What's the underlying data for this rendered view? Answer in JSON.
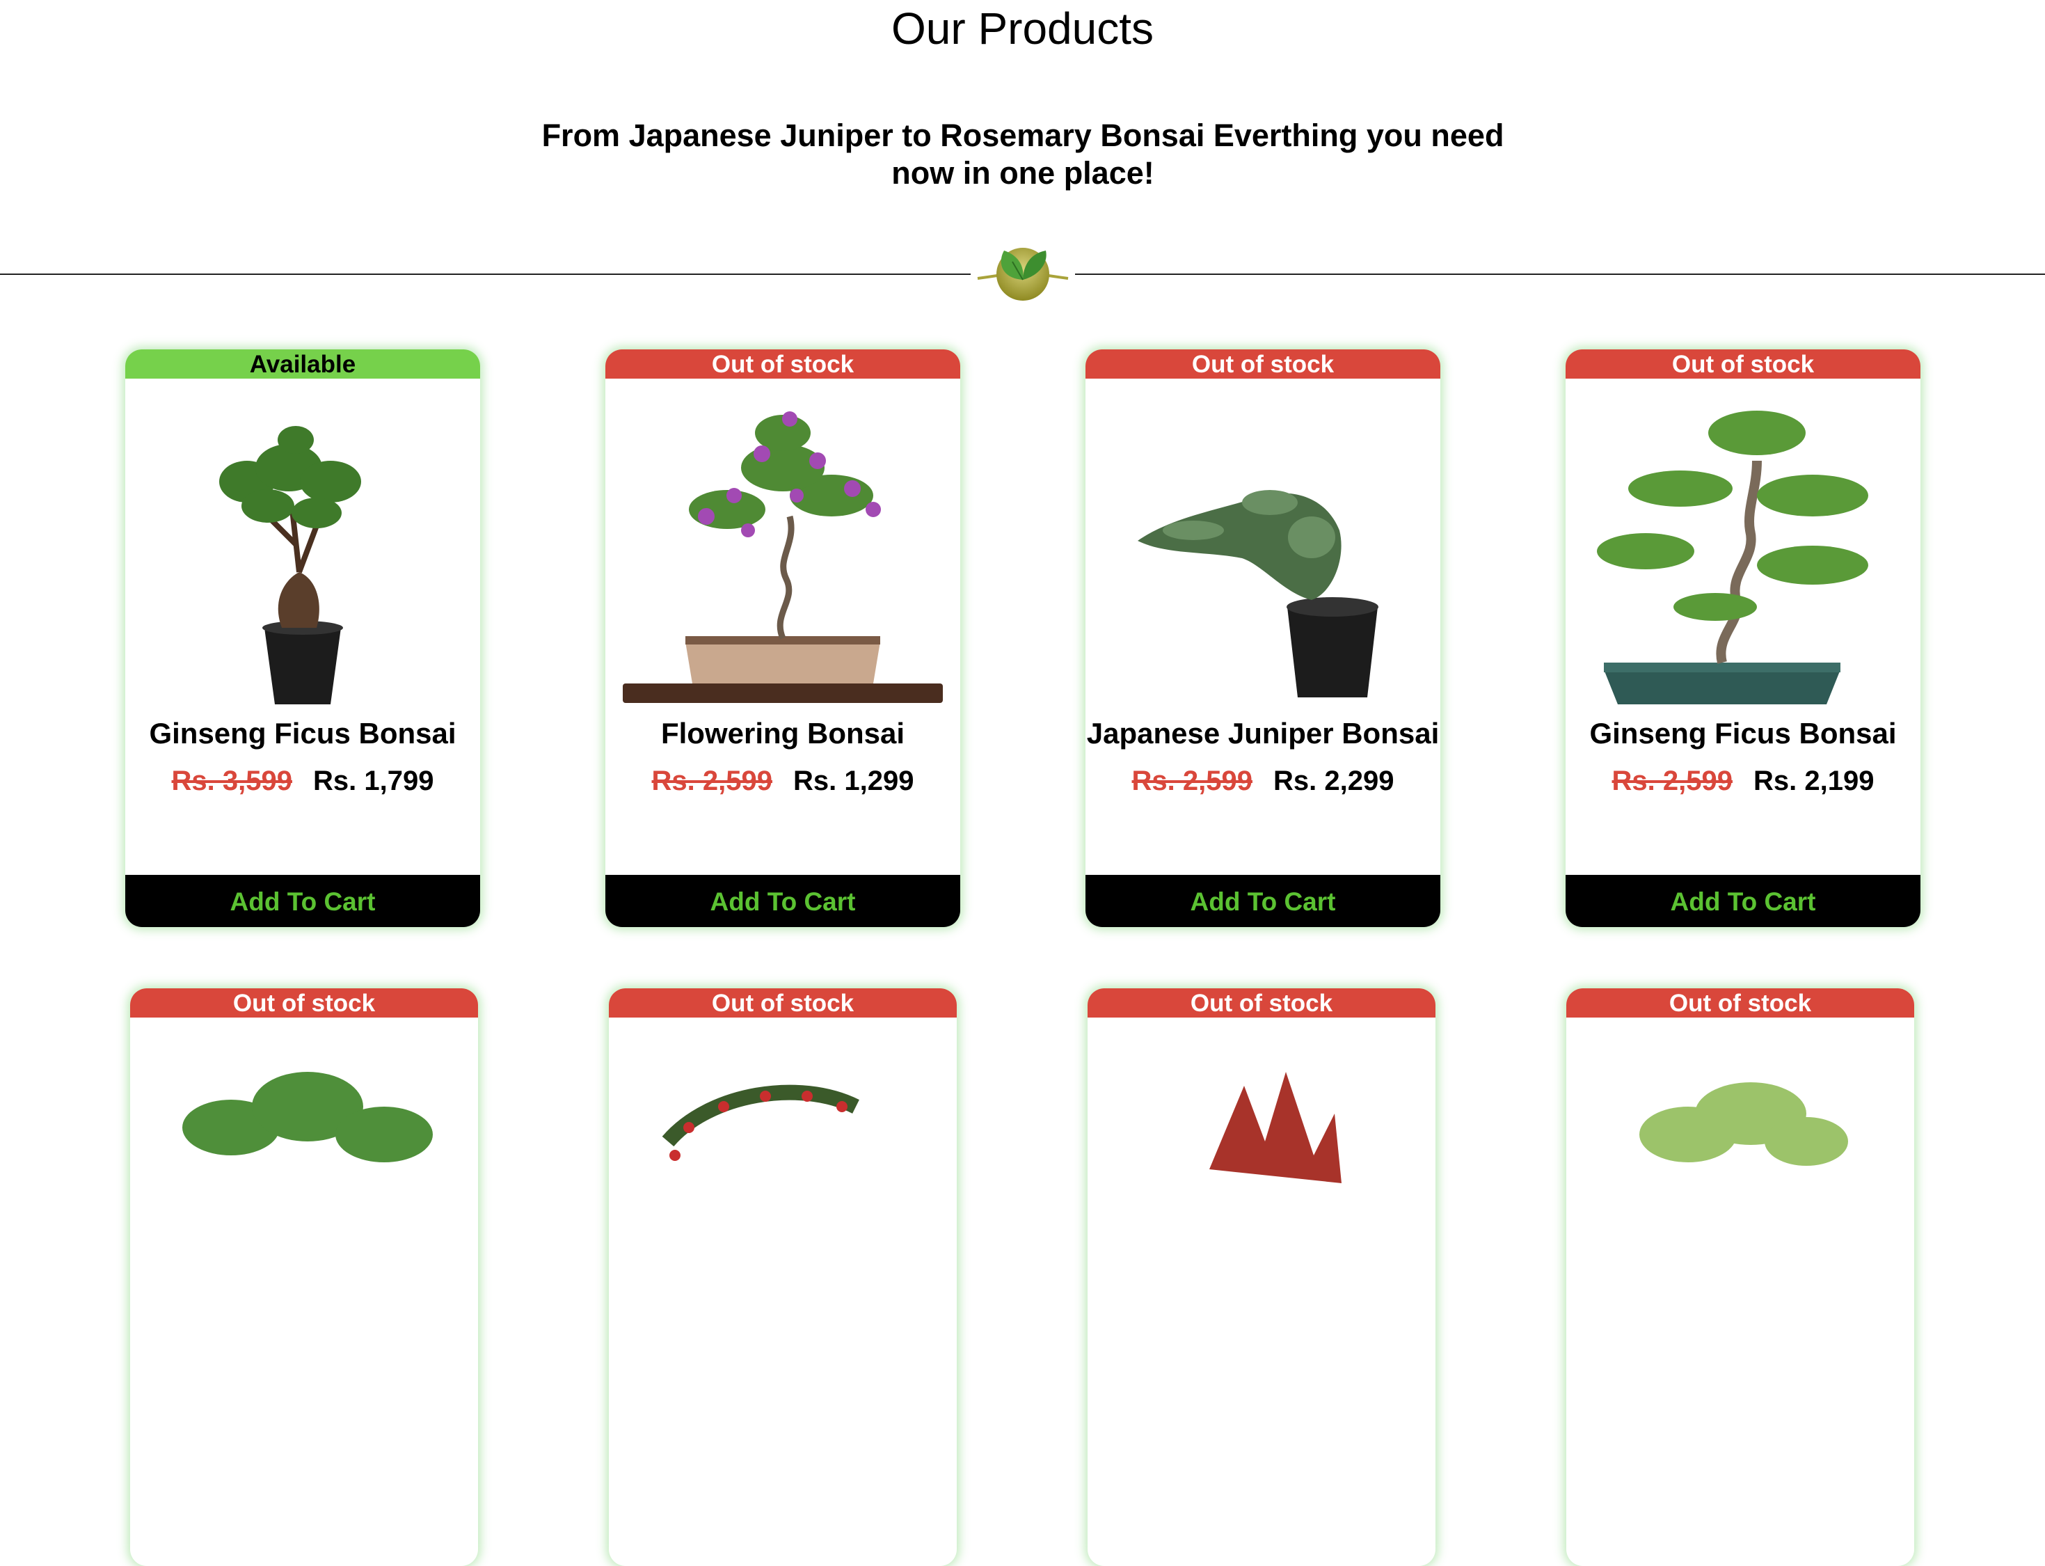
{
  "header": {
    "title": "Our Products",
    "subtitle_line1": "From Japanese Juniper to Rosemary Bonsai Everthing you need",
    "subtitle_line2": "now in one place!"
  },
  "colors": {
    "available": "#76d14b",
    "out_of_stock": "#d9473b",
    "cart_text": "#5bc232",
    "card_glow": "#78d26e"
  },
  "products": [
    {
      "status": "Available",
      "name": "Ginseng Ficus Bonsai",
      "old_price": "Rs. 3,599",
      "price": "Rs. 1,799",
      "cta": "Add To Cart",
      "image": "ficus-in-black-pot"
    },
    {
      "status": "Out of stock",
      "name": "Flowering Bonsai",
      "old_price": "Rs. 2,599",
      "price": "Rs. 1,299",
      "cta": "Add To Cart",
      "image": "flowering-bonsai-on-tray"
    },
    {
      "status": "Out of stock",
      "name": "Japanese Juniper Bonsai",
      "old_price": "Rs. 2,599",
      "price": "Rs. 2,299",
      "cta": "Add To Cart",
      "image": "juniper-in-black-pot"
    },
    {
      "status": "Out of stock",
      "name": "Ginseng Ficus Bonsai",
      "old_price": "Rs. 2,599",
      "price": "Rs. 2,199",
      "cta": "Add To Cart",
      "image": "bonsai-in-blue-tray"
    }
  ],
  "row2_products": [
    {
      "status": "Out of stock",
      "image": "jade-bonsai"
    },
    {
      "status": "Out of stock",
      "image": "berry-bonsai"
    },
    {
      "status": "Out of stock",
      "image": "red-maple-bonsai"
    },
    {
      "status": "Out of stock",
      "image": "light-green-bonsai"
    }
  ]
}
